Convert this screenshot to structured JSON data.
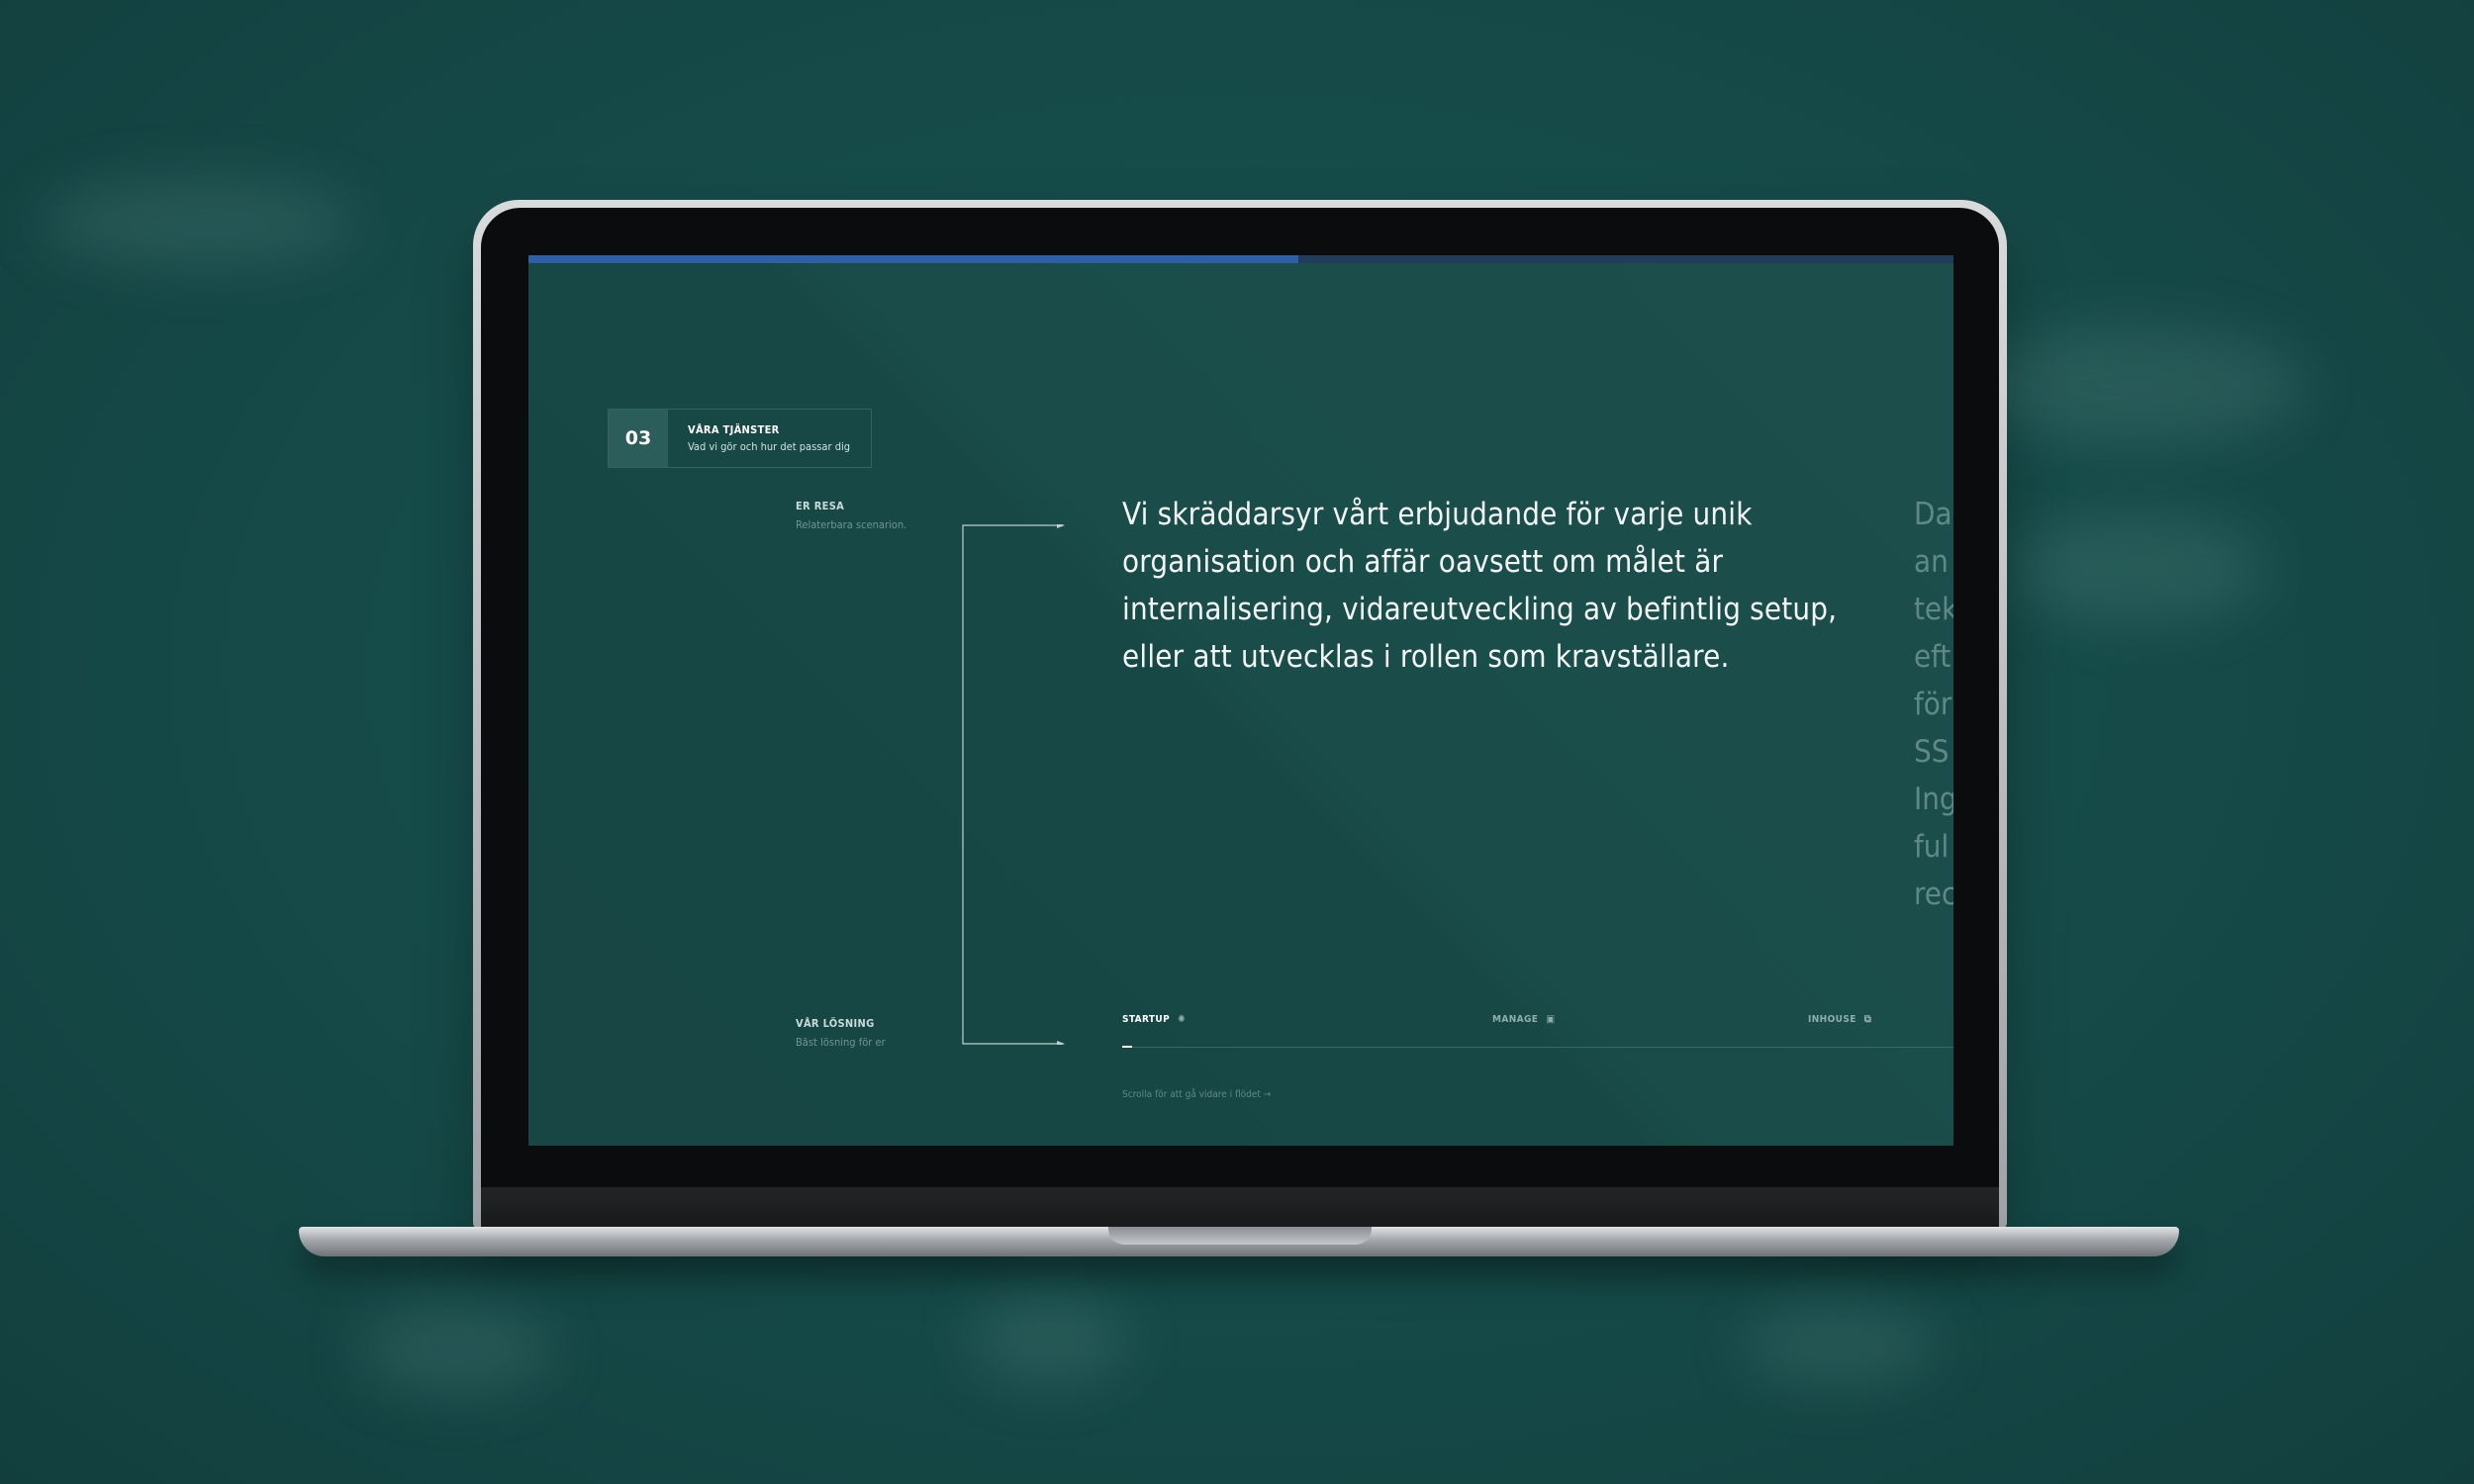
{
  "progress": {
    "value": 0.54,
    "track_color": "#223d5c",
    "fill_color": "#2f5fa6"
  },
  "section": {
    "number": "03",
    "title": "VÅRA TJÄNSTER",
    "subtitle": "Vad vi gör och hur det passar dig"
  },
  "journey": {
    "start": {
      "title": "ER RESA",
      "subtitle": "Relaterbara scenarion."
    },
    "end": {
      "title": "VÅR LÖSNING",
      "subtitle": "Bäst lösning för er"
    }
  },
  "main_text": "Vi skräddarsyr vårt erbjudande för varje unik organisation och affär oavsett om målet är internalisering, vidareutveckling av befintlig setup, eller att utvecklas i rollen som kravställare.",
  "next_text_lines": [
    "Da",
    "an",
    "tek",
    "eft",
    "för",
    "SS",
    "Ing",
    "ful",
    "rec"
  ],
  "tabs": [
    {
      "label": "STARTUP",
      "icon": "sun-icon",
      "glyph": "✺",
      "active": true
    },
    {
      "label": "MANAGE",
      "icon": "briefcase-icon",
      "glyph": "▣",
      "active": false
    },
    {
      "label": "INHOUSE",
      "icon": "link-icon",
      "glyph": "⧉",
      "active": false
    }
  ],
  "scroll_hint": "Scrolla för att gå vidare i flödet  →",
  "colors": {
    "background": "#154b49",
    "screen": "#1a4d4a",
    "accent": "#2f5fa6"
  }
}
